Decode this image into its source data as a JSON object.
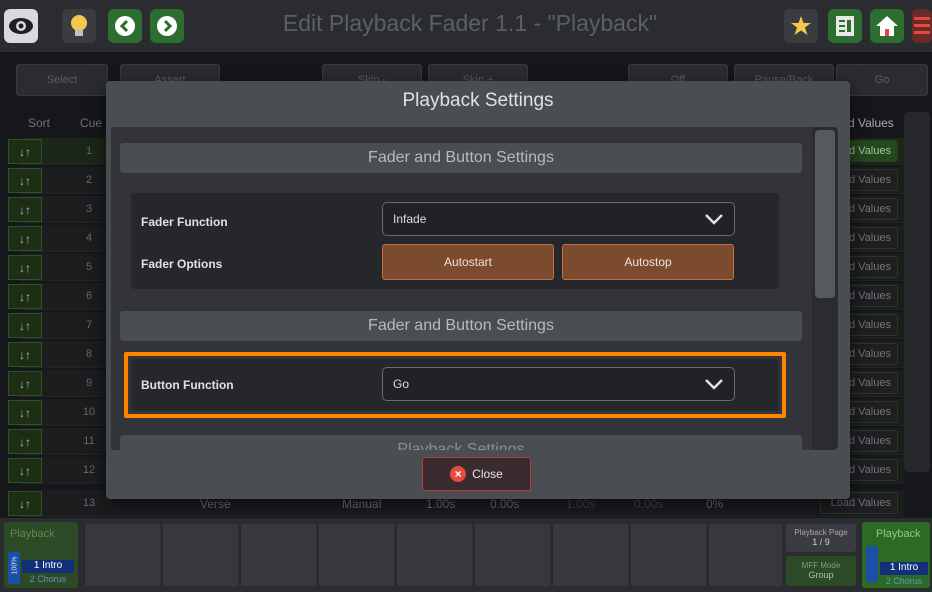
{
  "window": {
    "title": "Edit Playback Fader 1.1 - \"Playback\""
  },
  "topbar": {
    "icons": [
      "eye-icon",
      "bulb-icon",
      "back-icon",
      "forward-icon",
      "star-icon",
      "sheet-icon",
      "home-icon",
      "menu-icon"
    ]
  },
  "buttonrow": {
    "labels": [
      "Select",
      "Assert",
      "Skip -",
      "Skip +",
      "Off",
      "Pause/Back",
      "Go"
    ]
  },
  "list": {
    "headers": {
      "sort": "Sort",
      "cue": "Cue",
      "values": "d Values"
    },
    "rows": [
      {
        "num": "1"
      },
      {
        "num": "2"
      },
      {
        "num": "3"
      },
      {
        "num": "4"
      },
      {
        "num": "5"
      },
      {
        "num": "6"
      },
      {
        "num": "7"
      },
      {
        "num": "8"
      },
      {
        "num": "9"
      },
      {
        "num": "10"
      },
      {
        "num": "11"
      },
      {
        "num": "12"
      }
    ],
    "row_values_label": "d Values",
    "last_row": {
      "num": "13",
      "name": "Verse",
      "trigger": "Manual",
      "fade": "1.00s",
      "delay": "0.00s",
      "outfade": "1.00s",
      "outdelay": "0.00s",
      "pct": "0%",
      "values": "Load Values"
    }
  },
  "modal": {
    "title": "Playback Settings",
    "sections": [
      "Fader and Button Settings",
      "Fader and Button Settings",
      "Playback Settings"
    ],
    "fader_function": {
      "label": "Fader Function",
      "value": "Infade"
    },
    "fader_options": {
      "label": "Fader Options",
      "options": [
        "Autostart",
        "Autostop"
      ]
    },
    "button_function": {
      "label": "Button Function",
      "value": "Go"
    },
    "close_label": "Close"
  },
  "bottom": {
    "left_playback": {
      "title": "Playback",
      "level": "100%",
      "cue": "1 Intro",
      "next": "2 Chorus"
    },
    "page": {
      "label": "Playback Page",
      "value": "1 / 9"
    },
    "mff": {
      "label": "MFF Mode",
      "value": "Group"
    },
    "right_playback": {
      "title": "Playback",
      "cue": "1 Intro",
      "next": "2 Chorus"
    }
  }
}
